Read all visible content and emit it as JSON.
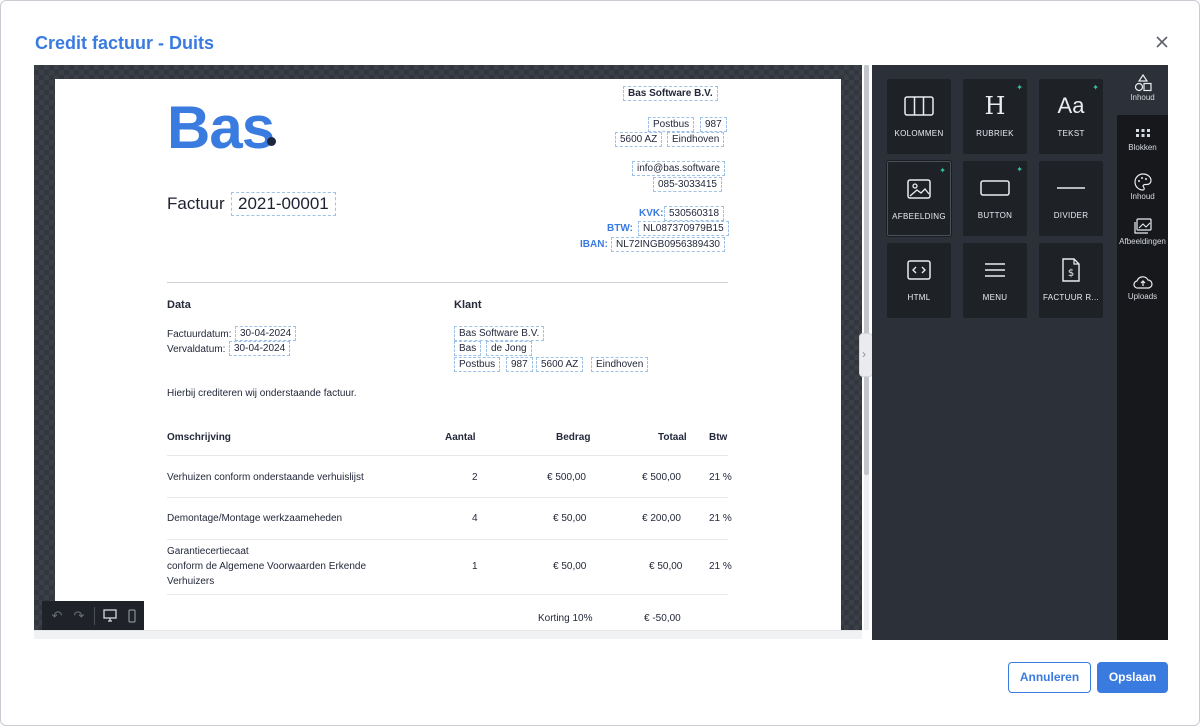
{
  "modal": {
    "title": "Credit factuur - Duits",
    "close_icon": "close-icon"
  },
  "invoice": {
    "logo": "Bas",
    "company_name": "Bas Software B.V.",
    "postbus": "Postbus",
    "postbus_no": "987",
    "postcode": "5600 AZ",
    "city": "Eindhoven",
    "email": "info@bas.software",
    "phone": "085-3033415",
    "kvk_label": "KVK:",
    "kvk": "530560318",
    "btw_label": "BTW:",
    "btw": "NL087370979B15",
    "iban_label": "IBAN:",
    "iban": "NL72INGB0956389430",
    "title": "Factuur",
    "number": "2021-00001",
    "data_heading": "Data",
    "invoice_date_label": "Factuurdatum:",
    "invoice_date": "30-04-2024",
    "due_date_label": "Vervaldatum:",
    "due_date": "30-04-2024",
    "client_heading": "Klant",
    "client_company": "Bas Software B.V.",
    "client_first": "Bas",
    "client_last": "de Jong",
    "client_postbus": "Postbus",
    "client_postbus_no": "987",
    "client_postcode": "5600 AZ",
    "client_city": "Eindhoven",
    "intro": "Hierbij crediteren wij onderstaande factuur.",
    "columns": {
      "desc": "Omschrijving",
      "qty": "Aantal",
      "amount": "Bedrag",
      "total": "Totaal",
      "vat": "Btw"
    },
    "rows": [
      {
        "desc": "Verhuizen conform onderstaande verhuislijst",
        "qty": "2",
        "amount": "€ 500,00",
        "total": "€ 500,00",
        "vat": "21 %"
      },
      {
        "desc": "Demontage/Montage werkzaameheden",
        "qty": "4",
        "amount": "€ 50,00",
        "total": "€ 200,00",
        "vat": "21 %"
      },
      {
        "desc_lines": [
          "Garantiecertiecaat",
          "conform de Algemene Voorwaarden Erkende",
          "Verhuizers"
        ],
        "qty": "1",
        "amount": "€ 50,00",
        "total": "€ 50,00",
        "vat": "21 %"
      }
    ],
    "discount_label": "Korting 10%",
    "discount_value": "€ -50,00"
  },
  "tools": [
    {
      "label": "KOLOMMEN",
      "icon": "columns-icon",
      "ai": false
    },
    {
      "label": "RUBRIEK",
      "icon": "heading-icon",
      "ai": true
    },
    {
      "label": "TEKST",
      "icon": "text-icon",
      "ai": true
    },
    {
      "label": "AFBEELDING",
      "icon": "image-icon",
      "ai": true
    },
    {
      "label": "BUTTON",
      "icon": "button-icon",
      "ai": true
    },
    {
      "label": "DIVIDER",
      "icon": "divider-icon",
      "ai": false
    },
    {
      "label": "HTML",
      "icon": "html-icon",
      "ai": false
    },
    {
      "label": "MENU",
      "icon": "menu-icon",
      "ai": false
    },
    {
      "label": "FACTUUR R...",
      "icon": "invoice-doc-icon",
      "ai": false
    }
  ],
  "sidebar": [
    {
      "label": "Inhoud",
      "icon": "shapes-icon"
    },
    {
      "label": "Blokken",
      "icon": "blocks-icon"
    },
    {
      "label": "Inhoud",
      "icon": "palette-icon"
    },
    {
      "label": "Afbeeldingen",
      "icon": "images-icon"
    },
    {
      "label": "Uploads",
      "icon": "cloud-upload-icon"
    }
  ],
  "buttons": {
    "cancel": "Annuleren",
    "save": "Opslaan"
  },
  "colors": {
    "accent": "#3a7be0",
    "panel": "#2c3038",
    "ai_spark": "#35c3a0"
  }
}
